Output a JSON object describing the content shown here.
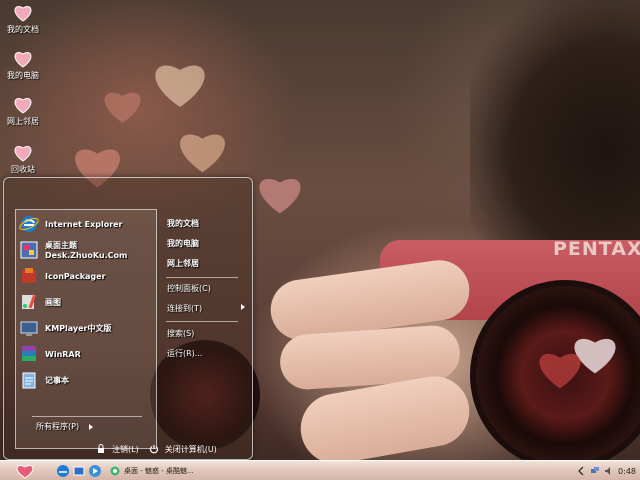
{
  "desktop": {
    "icons": [
      {
        "label": "我的文档",
        "icon": "heart-icon"
      },
      {
        "label": "我的电脑",
        "icon": "heart-icon"
      },
      {
        "label": "网上邻居",
        "icon": "heart-icon"
      },
      {
        "label": "回收站",
        "icon": "heart-icon"
      }
    ],
    "wallpaper_text": "PENTAX"
  },
  "start_menu": {
    "pinned": [
      {
        "label": "Internet Explorer",
        "icon": "internet-explorer-icon"
      },
      {
        "label": "桌面主题Desk.ZhuoKu.Com",
        "icon": "theme-icon"
      },
      {
        "label": "IconPackager",
        "icon": "iconpackager-icon"
      },
      {
        "label": "画图",
        "icon": "paint-icon"
      },
      {
        "label": "KMPlayer中文版",
        "icon": "kmplayer-icon"
      },
      {
        "label": "WinRAR",
        "icon": "winrar-icon"
      },
      {
        "label": "记事本",
        "icon": "notepad-icon"
      }
    ],
    "all_programs": "所有程序(P)",
    "right": {
      "my_documents": "我的文档",
      "my_computer": "我的电脑",
      "network": "网上邻居",
      "control_panel": "控制面板(C)",
      "connect_to": "连接到(T)",
      "search": "搜索(S)",
      "run": "运行(R)..."
    },
    "logoff": "注销(L)",
    "shutdown": "关闭计算机(U)"
  },
  "taskbar": {
    "task_label": "桌面 - 魅惑 - 桌酷魅...",
    "clock": "0:48"
  },
  "colors": {
    "taskbar": "#e2c9bd",
    "heart": "#f4a9b8"
  }
}
